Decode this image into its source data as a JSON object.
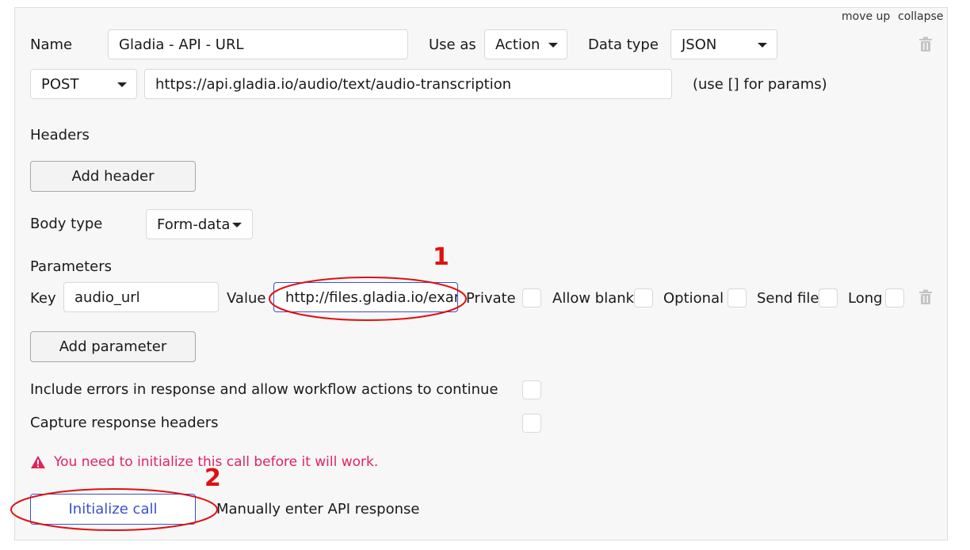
{
  "header": {
    "move_up": "move up",
    "collapse": "collapse"
  },
  "call": {
    "name_label": "Name",
    "name_value": "Gladia - API - URL",
    "use_as_label": "Use as",
    "use_as_value": "Action",
    "data_type_label": "Data type",
    "data_type_value": "JSON",
    "method_value": "POST",
    "url_value": "https://api.gladia.io/audio/text/audio-transcription",
    "url_hint": "(use [] for params)"
  },
  "headers": {
    "label": "Headers",
    "add_button": "Add header"
  },
  "body": {
    "label": "Body type",
    "value": "Form-data"
  },
  "parameters": {
    "label": "Parameters",
    "key_label": "Key",
    "key_value": "audio_url",
    "value_label": "Value",
    "value_value": "http://files.gladia.io/exam",
    "private_label": "Private",
    "allow_blank_label": "Allow blank",
    "optional_label": "Optional",
    "send_file_label": "Send file",
    "long_label": "Long",
    "add_button": "Add parameter"
  },
  "options": {
    "include_errors": "Include errors in response and allow workflow actions to continue",
    "capture_headers": "Capture response headers"
  },
  "warning": "You need to initialize this call before it will work.",
  "actions": {
    "initialize": "Initialize call",
    "manual": "Manually enter API response"
  },
  "annotations": {
    "first": "1",
    "second": "2"
  },
  "colors": {
    "warning": "#e0245e",
    "annotation": "#e01010",
    "primary": "#3a4fd1"
  }
}
